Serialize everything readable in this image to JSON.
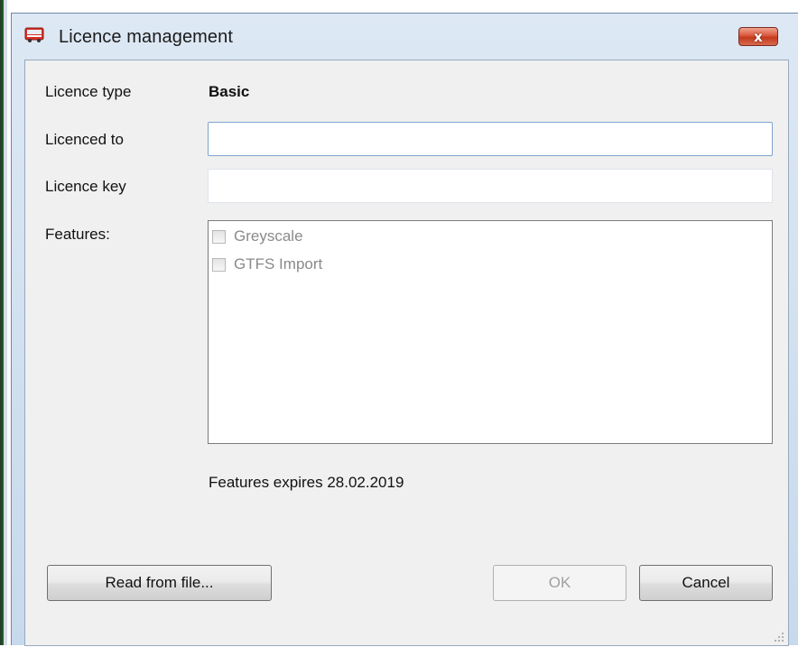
{
  "window": {
    "title": "Licence management",
    "close_label": "x"
  },
  "form": {
    "licence_type_label": "Licence type",
    "licence_type_value": "Basic",
    "licenced_to_label": "Licenced to",
    "licenced_to_value": "",
    "licence_key_label": "Licence key",
    "licence_key_value": "",
    "features_label": "Features:",
    "features": [
      {
        "label": "Greyscale",
        "checked": false,
        "enabled": false
      },
      {
        "label": "GTFS Import",
        "checked": false,
        "enabled": false
      }
    ],
    "expiry_text": "Features expires 28.02.2019"
  },
  "buttons": {
    "read_from_file": "Read from file...",
    "ok": "OK",
    "cancel": "Cancel"
  },
  "colors": {
    "titlebar_top": "#dde8f4",
    "client_bg": "#f0f0f0",
    "close_red": "#c33a1d",
    "textbox_border_active": "#7fa4cc",
    "disabled_text": "#8a8a8a"
  },
  "icons": {
    "app": "bus-icon",
    "close": "close-icon",
    "resize": "resize-grip-icon"
  }
}
